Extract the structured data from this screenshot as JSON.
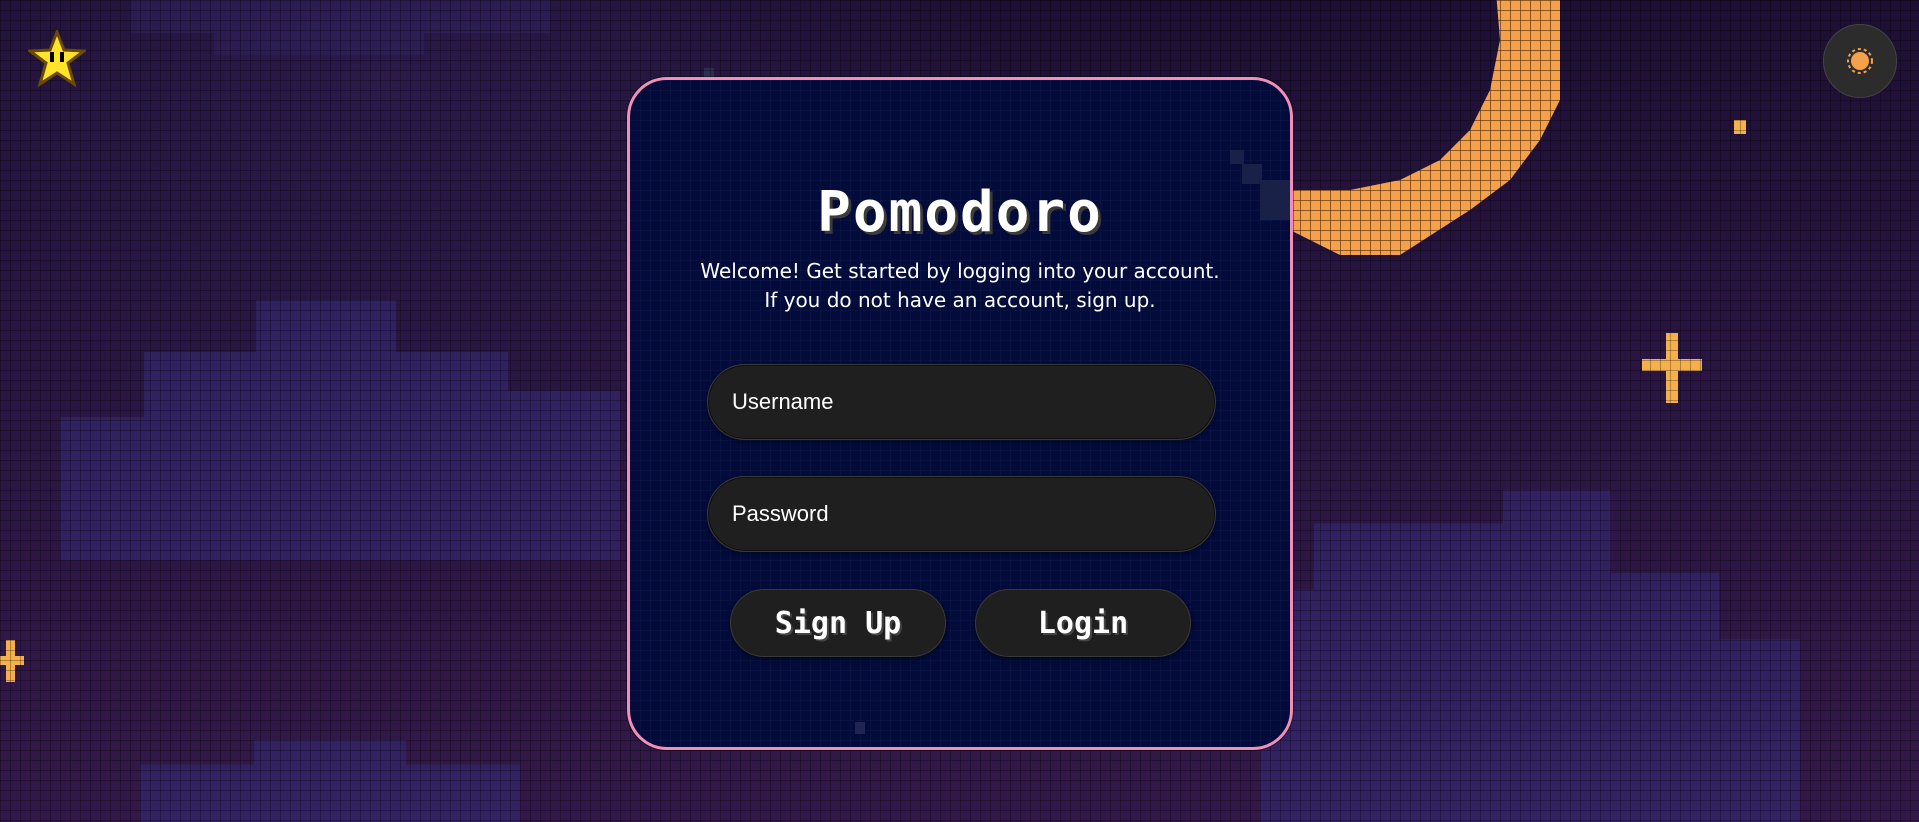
{
  "app": {
    "title": "Pomodoro",
    "welcome_line1": "Welcome! Get started by logging into your account.",
    "welcome_line2": "If you do not have an account, sign up."
  },
  "form": {
    "username_placeholder": "Username",
    "username_value": "",
    "password_placeholder": "Password",
    "password_value": ""
  },
  "buttons": {
    "signup_label": "Sign Up",
    "login_label": "Login"
  },
  "icons": {
    "logo": "star-icon",
    "theme_toggle": "sun-icon"
  },
  "colors": {
    "card_border": "#f08fb8",
    "card_bg": "#020b3a",
    "moon": "#f5a04a",
    "sparkle": "#f5b04a",
    "field_bg": "#1f1f1f"
  }
}
